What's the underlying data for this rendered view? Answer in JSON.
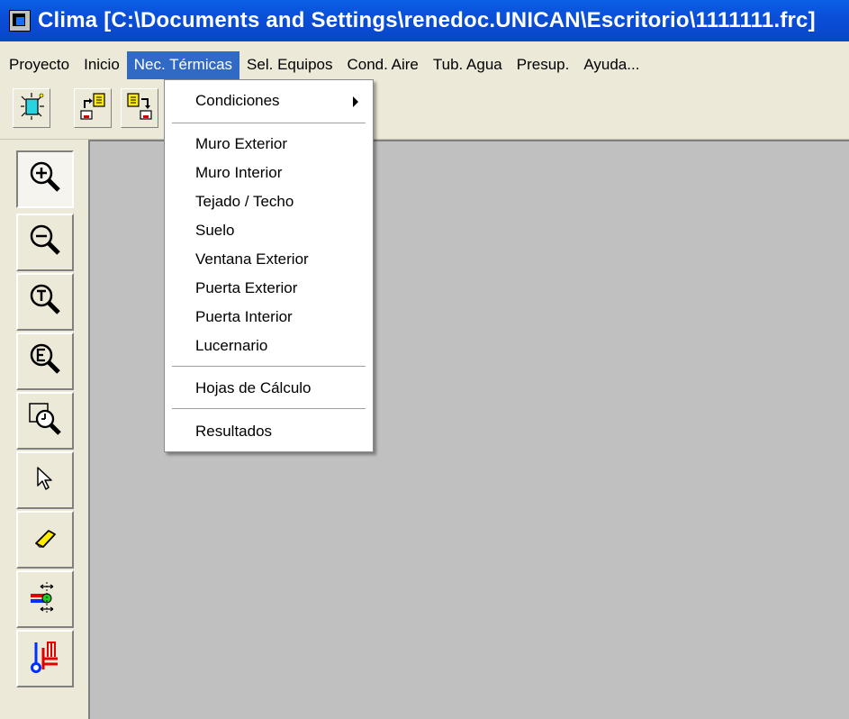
{
  "window": {
    "title": "Clima [C:\\Documents and Settings\\renedoc.UNICAN\\Escritorio\\1111111.frc]"
  },
  "menubar": {
    "items": [
      "Proyecto",
      "Inicio",
      "Nec. Térmicas",
      "Sel. Equipos",
      "Cond. Aire",
      "Tub. Agua",
      "Presup.",
      "Ayuda..."
    ],
    "active_index": 2
  },
  "dropdown": {
    "items": [
      {
        "label": "Condiciones",
        "submenu": true
      },
      {
        "label": "Muro Exterior"
      },
      {
        "label": "Muro Interior"
      },
      {
        "label": "Tejado / Techo"
      },
      {
        "label": "Suelo"
      },
      {
        "label": "Ventana Exterior"
      },
      {
        "label": "Puerta Exterior"
      },
      {
        "label": "Puerta Interior"
      },
      {
        "label": "Lucernario"
      },
      {
        "label": "Hojas de Cálculo"
      },
      {
        "label": "Resultados"
      }
    ]
  },
  "toolbar": {
    "buttons": [
      "new-project-icon",
      "open-file-icon",
      "save-file-icon"
    ]
  },
  "leftbar": {
    "tools": [
      "zoom-in-icon",
      "zoom-out-icon",
      "zoom-total-icon",
      "zoom-extents-icon",
      "zoom-window-icon",
      "select-arrow-icon",
      "eraser-icon",
      "connect-node-icon",
      "thermometer-radiator-icon"
    ],
    "pressed_index": 0
  },
  "colors": {
    "titlebar": "#0a4fd8",
    "menu_highlight": "#316ac5",
    "canvas": "#c0c0c0"
  }
}
